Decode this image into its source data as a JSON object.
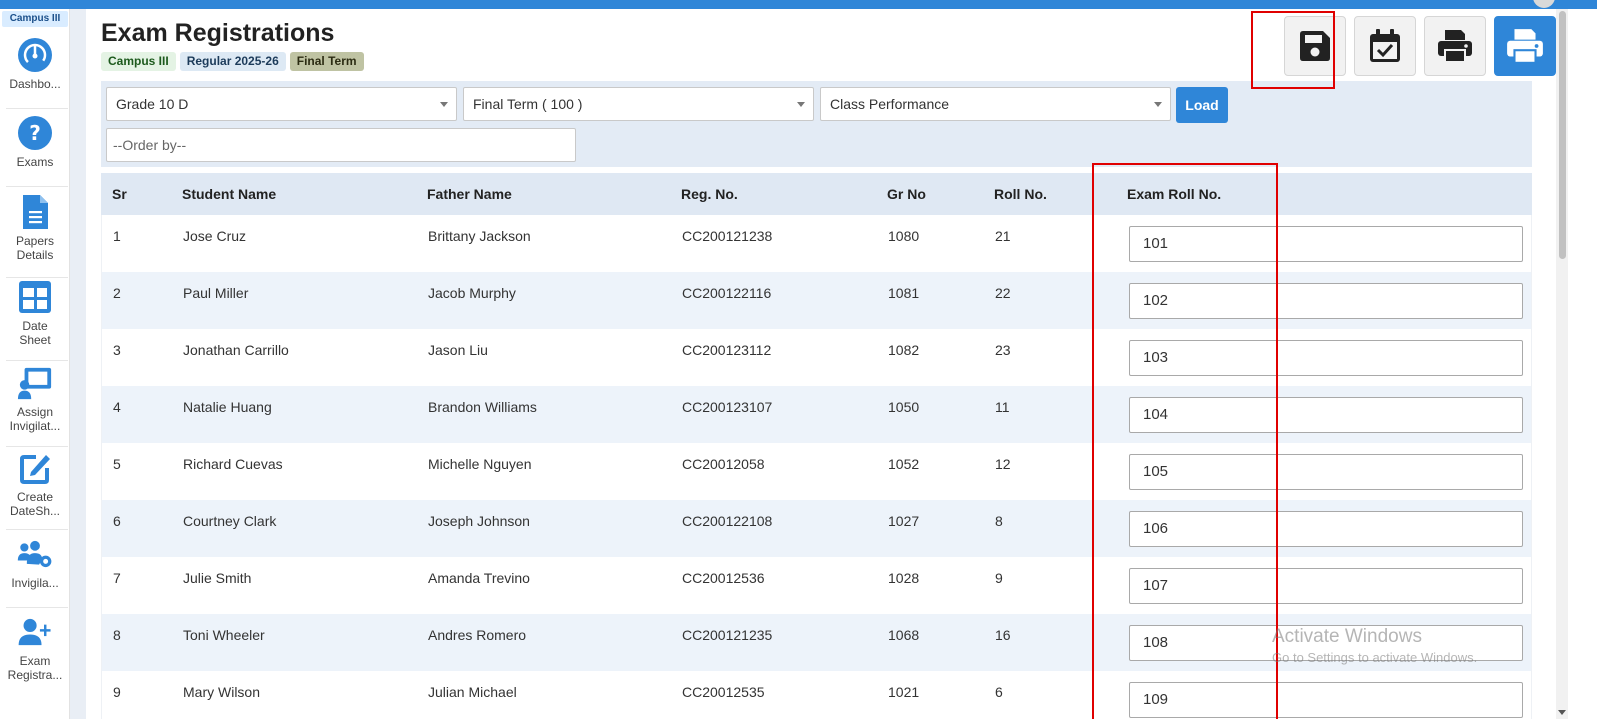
{
  "colors": {
    "accent": "#2f86d8",
    "highlight": "#e00000"
  },
  "sidebar": {
    "campus_tag": "Campus III",
    "items": [
      {
        "label": "Dashbo...",
        "icon": "dashboard-gauge-icon"
      },
      {
        "label": "Exams",
        "icon": "question-circle-icon"
      },
      {
        "label": "Papers Details",
        "icon": "document-icon"
      },
      {
        "label": "Date Sheet",
        "icon": "grid-table-icon"
      },
      {
        "label": "Assign Invigilat...",
        "icon": "presenter-board-icon"
      },
      {
        "label": "Create DateSh...",
        "icon": "edit-pencil-icon"
      },
      {
        "label": "Invigila...",
        "icon": "users-gear-icon"
      },
      {
        "label": "Exam Registra...",
        "icon": "user-plus-icon"
      }
    ]
  },
  "header": {
    "title": "Exam Registrations",
    "chips": [
      "Campus III",
      "Regular 2025-26",
      "Final Term"
    ]
  },
  "toolbar": {
    "buttons": [
      {
        "name": "save",
        "icon": "save-floppy-icon"
      },
      {
        "name": "calendar-check",
        "icon": "calendar-check-icon"
      },
      {
        "name": "print",
        "icon": "printer-icon"
      },
      {
        "name": "print-primary",
        "icon": "printer-icon"
      }
    ]
  },
  "filters": {
    "class_select": "Grade 10 D",
    "term_select": "Final Term ( 100 )",
    "report_select": "Class Performance",
    "load_label": "Load",
    "order_by_placeholder": "--Order by--"
  },
  "table": {
    "headers": [
      "Sr",
      "Student Name",
      "Father Name",
      "Reg. No.",
      "Gr No",
      "Roll No.",
      "Exam Roll No."
    ],
    "rows": [
      {
        "sr": "1",
        "student": "Jose Cruz",
        "father": "Brittany Jackson",
        "reg": "CC200121238",
        "gr": "1080",
        "roll": "21",
        "exam_roll": "101"
      },
      {
        "sr": "2",
        "student": "Paul Miller",
        "father": "Jacob Murphy",
        "reg": "CC200122116",
        "gr": "1081",
        "roll": "22",
        "exam_roll": "102"
      },
      {
        "sr": "3",
        "student": "Jonathan Carrillo",
        "father": "Jason Liu",
        "reg": "CC200123112",
        "gr": "1082",
        "roll": "23",
        "exam_roll": "103"
      },
      {
        "sr": "4",
        "student": "Natalie Huang",
        "father": "Brandon Williams",
        "reg": "CC200123107",
        "gr": "1050",
        "roll": "11",
        "exam_roll": "104"
      },
      {
        "sr": "5",
        "student": "Richard Cuevas",
        "father": "Michelle Nguyen",
        "reg": "CC20012058",
        "gr": "1052",
        "roll": "12",
        "exam_roll": "105"
      },
      {
        "sr": "6",
        "student": "Courtney Clark",
        "father": "Joseph Johnson",
        "reg": "CC200122108",
        "gr": "1027",
        "roll": "8",
        "exam_roll": "106"
      },
      {
        "sr": "7",
        "student": "Julie Smith",
        "father": "Amanda Trevino",
        "reg": "CC20012536",
        "gr": "1028",
        "roll": "9",
        "exam_roll": "107"
      },
      {
        "sr": "8",
        "student": "Toni Wheeler",
        "father": "Andres Romero",
        "reg": "CC200121235",
        "gr": "1068",
        "roll": "16",
        "exam_roll": "108"
      },
      {
        "sr": "9",
        "student": "Mary Wilson",
        "father": "Julian Michael",
        "reg": "CC20012535",
        "gr": "1021",
        "roll": "6",
        "exam_roll": "109"
      }
    ]
  },
  "watermark": {
    "line1": "Activate Windows",
    "line2": "Go to Settings to activate Windows."
  }
}
